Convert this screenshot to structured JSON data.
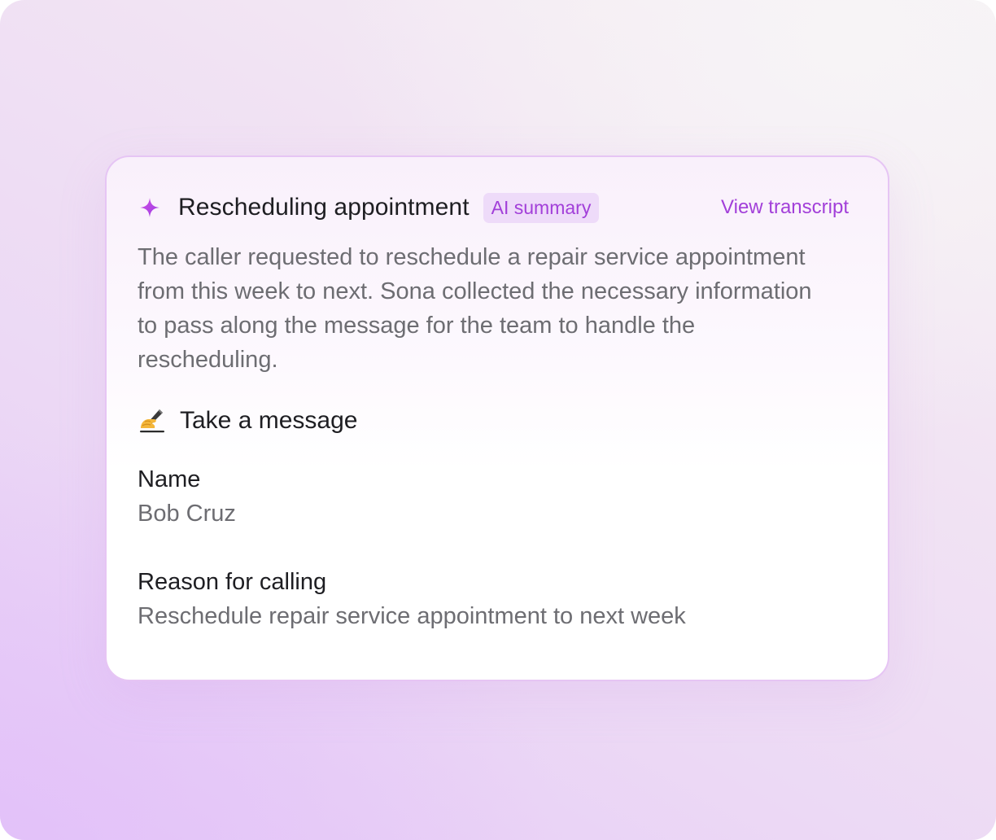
{
  "card": {
    "title": "Rescheduling appointment",
    "badge": "AI summary",
    "view_transcript": "View transcript",
    "summary": "The caller requested to reschedule a repair service appointment from this week to next. Sona collected the necessary information to pass along the message for the team to handle the rescheduling.",
    "sparkle_icon": "sparkle-icon",
    "accent_color": "#a23fd9"
  },
  "message_section": {
    "icon": "writing-hand-icon",
    "title": "Take a message",
    "fields": [
      {
        "label": "Name",
        "value": "Bob Cruz"
      },
      {
        "label": "Reason for calling",
        "value": "Reschedule repair service appointment to next week"
      }
    ]
  }
}
